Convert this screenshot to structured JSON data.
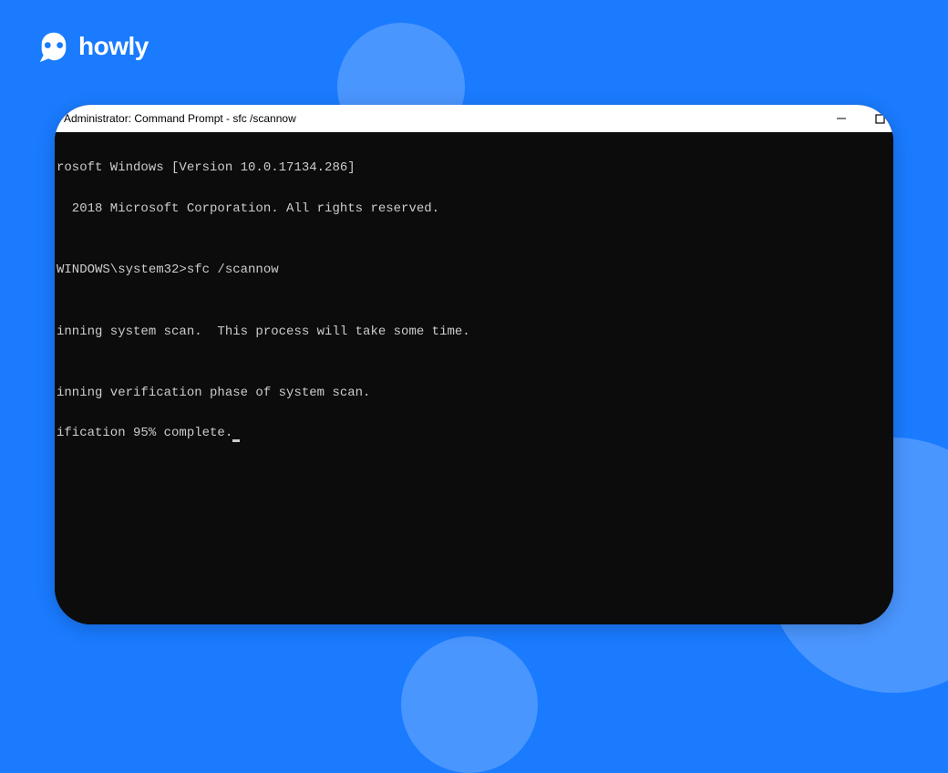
{
  "brand": {
    "name": "howly"
  },
  "window": {
    "title": "Administrator: Command Prompt - sfc  /scannow"
  },
  "terminal": {
    "lines": [
      "rosoft Windows [Version 10.0.17134.286]",
      "  2018 Microsoft Corporation. All rights reserved.",
      "",
      "WINDOWS\\system32>sfc /scannow",
      "",
      "inning system scan.  This process will take some time.",
      "",
      "inning verification phase of system scan.",
      "ification 95% complete."
    ]
  }
}
